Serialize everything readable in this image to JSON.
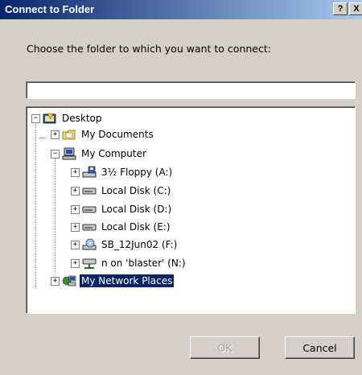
{
  "dialog": {
    "title": "Connect to Folder",
    "help_button": "?",
    "close_button": "X",
    "prompt": "Choose the folder to which you want to connect:",
    "path_value": ""
  },
  "tree": {
    "items": [
      {
        "label": "Desktop",
        "icon": "desktop-icon",
        "expander": "−"
      },
      {
        "label": "My Documents",
        "icon": "my-documents-icon",
        "expander": "+"
      },
      {
        "label": "My Computer",
        "icon": "my-computer-icon",
        "expander": "−"
      },
      {
        "label": "3½ Floppy (A:)",
        "icon": "floppy-drive-icon",
        "expander": "+"
      },
      {
        "label": "Local Disk (C:)",
        "icon": "hard-disk-icon",
        "expander": "+"
      },
      {
        "label": "Local Disk (D:)",
        "icon": "hard-disk-icon",
        "expander": "+"
      },
      {
        "label": "Local Disk (E:)",
        "icon": "hard-disk-icon",
        "expander": "+"
      },
      {
        "label": "SB_12Jun02 (F:)",
        "icon": "cd-drive-icon",
        "expander": "+"
      },
      {
        "label": "n on 'blaster' (N:)",
        "icon": "network-drive-icon",
        "expander": "+"
      },
      {
        "label": "My Network Places",
        "icon": "network-places-icon",
        "expander": "+",
        "selected": true
      }
    ]
  },
  "buttons": {
    "ok_label": "OK",
    "cancel_label": "Cancel"
  },
  "colors": {
    "title_start": "#0a246a",
    "title_end": "#a6caf0",
    "selection": "#0a246a",
    "face": "#d4d0c8"
  }
}
